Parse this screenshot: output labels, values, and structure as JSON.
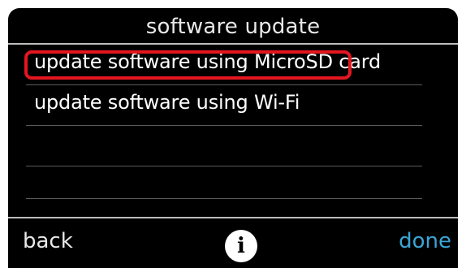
{
  "screen": {
    "title": "software update"
  },
  "options": [
    {
      "label": "update software using MicroSD card",
      "selected": true
    },
    {
      "label": "update software using Wi-Fi",
      "selected": false
    },
    {
      "label": "",
      "selected": false
    },
    {
      "label": "",
      "selected": false
    }
  ],
  "footer": {
    "back_label": "back",
    "info_icon": "i",
    "done_label": "done"
  },
  "colors": {
    "background": "#000000",
    "text": "#ffffff",
    "accent_done": "#3aa6d6",
    "highlight": "#e3161f"
  }
}
